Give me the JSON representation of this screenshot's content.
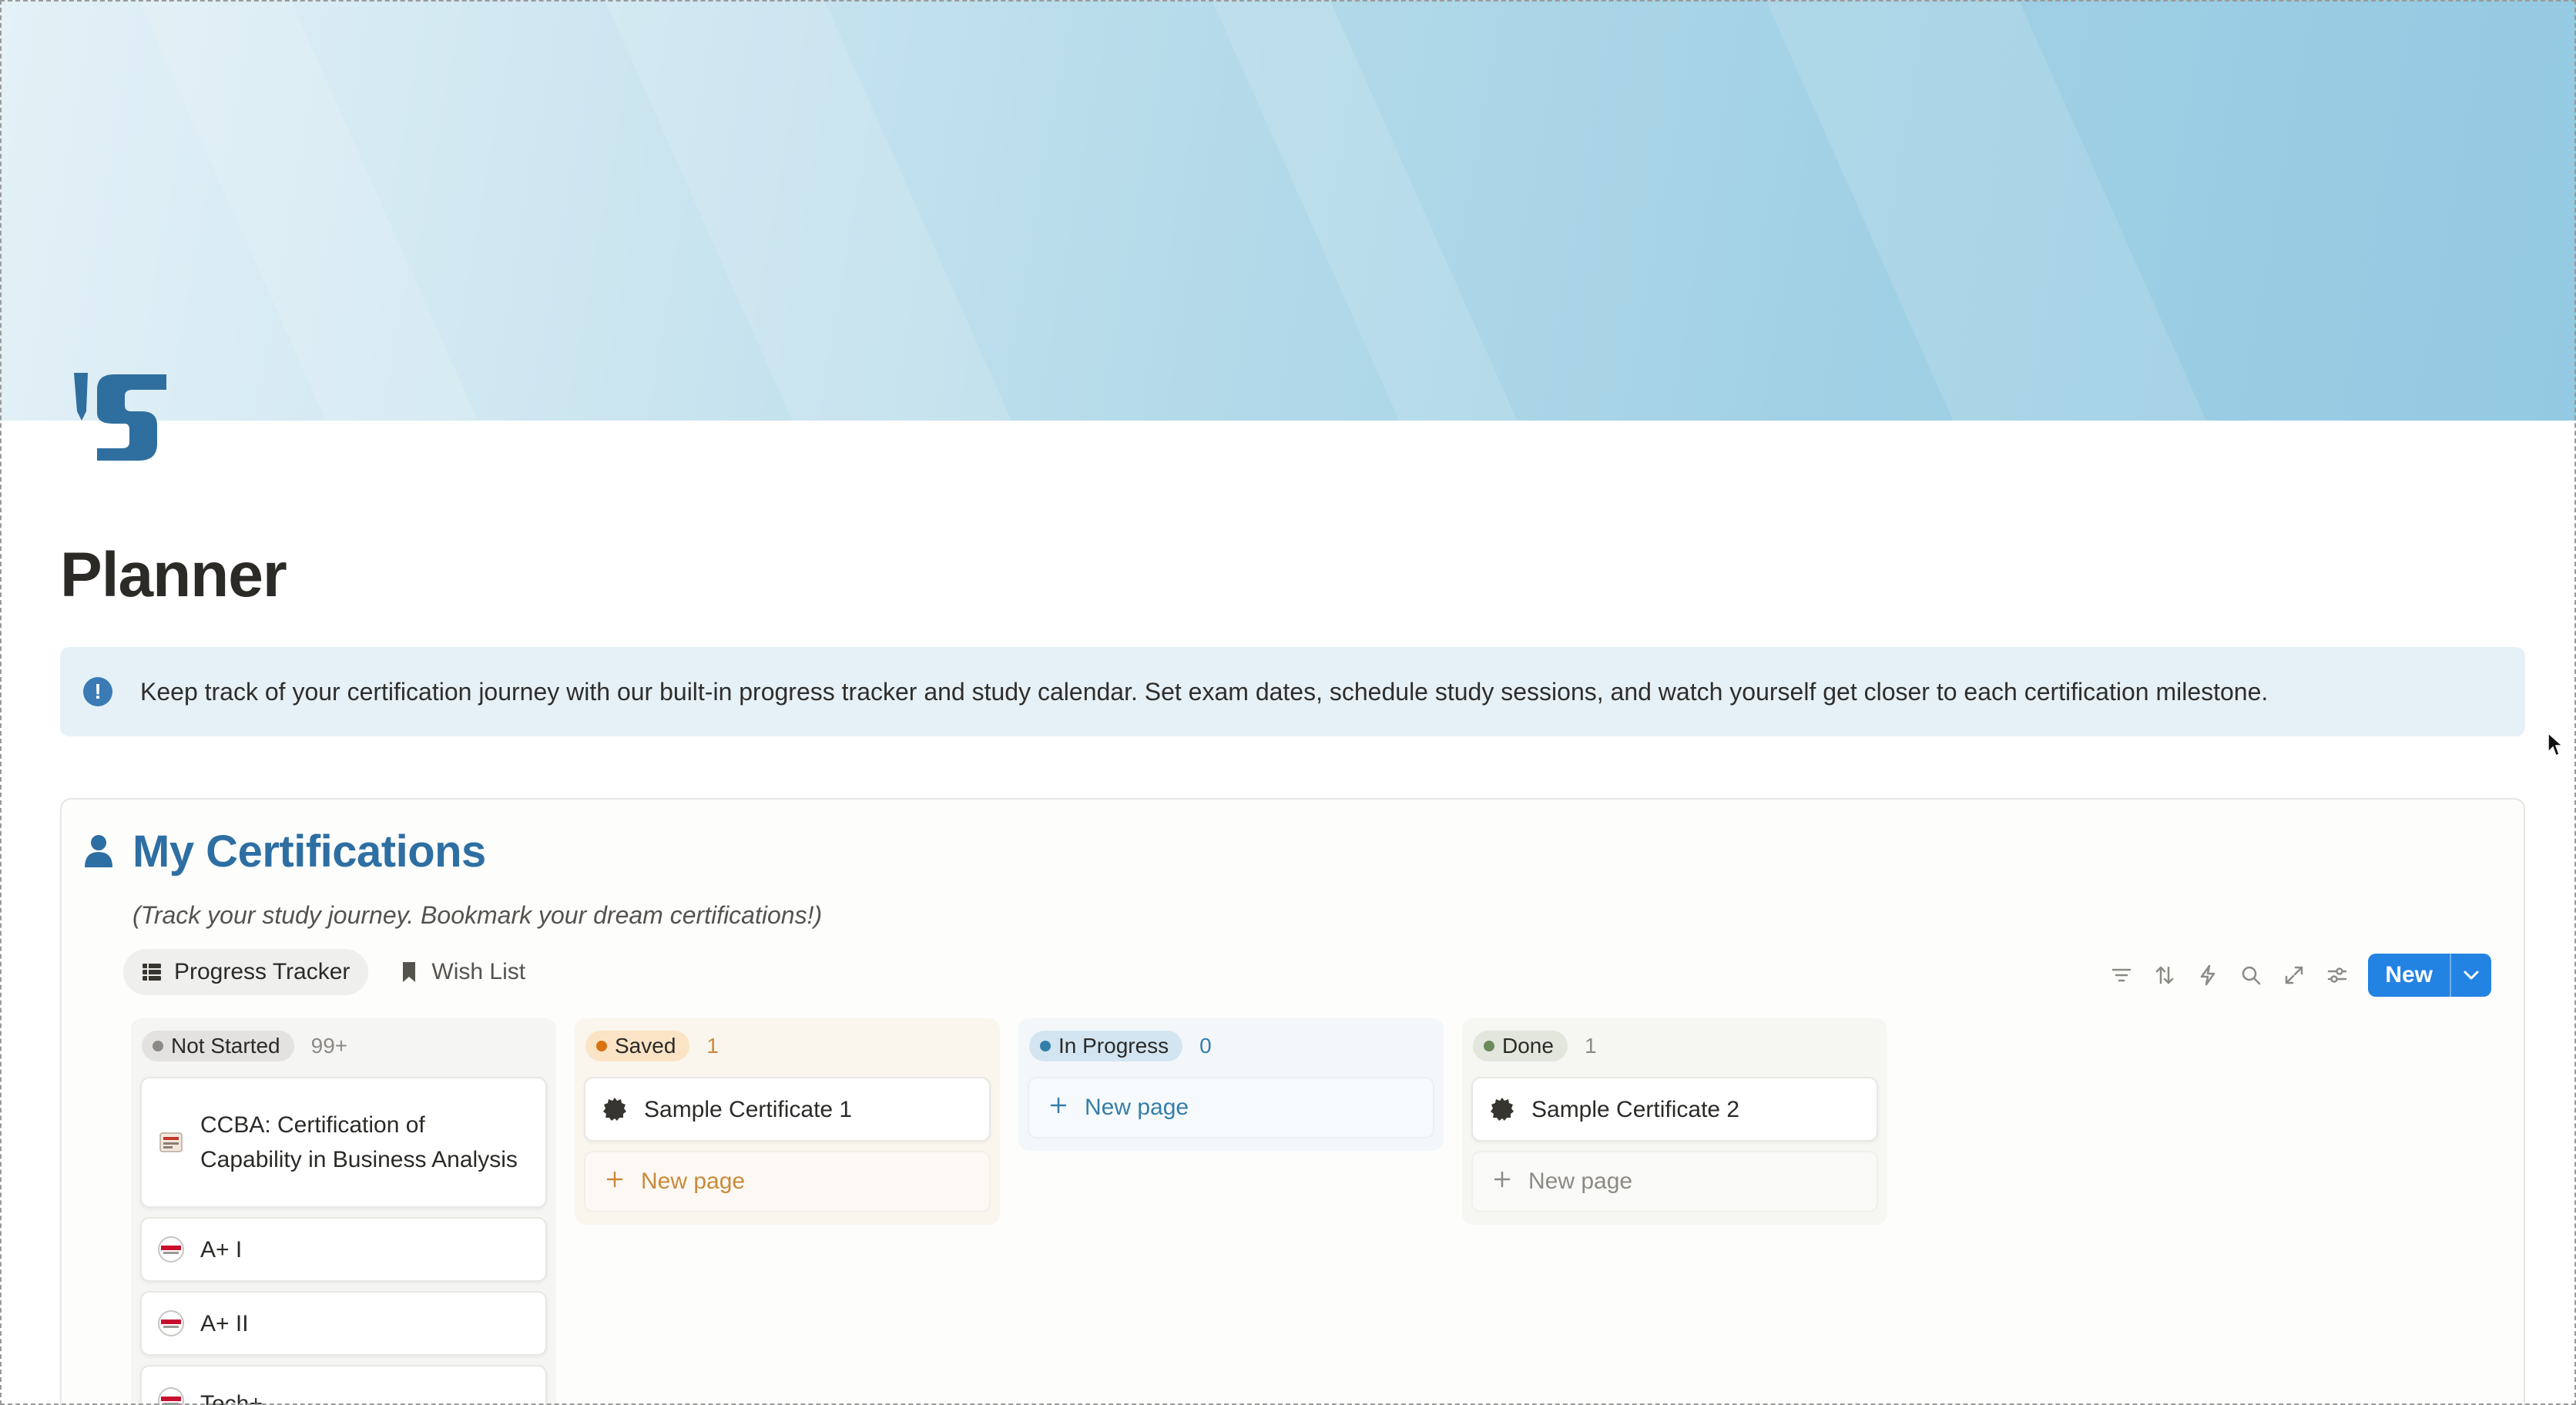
{
  "page": {
    "title": "Planner",
    "icon": "ss-logo-icon"
  },
  "callout": {
    "icon": "exclamation-icon",
    "text": "Keep track of your certification journey with our built-in progress tracker and study calendar. Set exam dates, schedule study sessions, and watch yourself get closer to each certification milestone."
  },
  "database": {
    "icon": "person-icon",
    "title": "My Certifications",
    "description": "(Track your study journey. Bookmark your dream certifications!)",
    "views": [
      {
        "label": "Progress Tracker",
        "icon": "table-icon",
        "active": true
      },
      {
        "label": "Wish List",
        "icon": "bookmark-icon",
        "active": false
      }
    ],
    "toolbar": {
      "icons": [
        "filter-icon",
        "sort-icon",
        "lightning-icon",
        "search-icon",
        "expand-icon",
        "settings-icon"
      ],
      "new_label": "New"
    }
  },
  "board": {
    "new_page_label": "New page",
    "columns": [
      {
        "status": "Not Started",
        "count": "99+",
        "colors": {
          "bg": "#f5f5f3",
          "pill": "#e3e2e0",
          "dot": "#8c8a85",
          "count": "#8c8a85"
        },
        "cards": [
          {
            "title": "CCBA: Certification of Capability in Business Analysis",
            "icon": "certificate-badge-icon"
          },
          {
            "title": "A+ I",
            "icon": "comptia-logo-icon"
          },
          {
            "title": "A+ II",
            "icon": "comptia-logo-icon"
          },
          {
            "title": "Tech+",
            "icon": "comptia-logo-icon"
          }
        ]
      },
      {
        "status": "Saved",
        "count": "1",
        "colors": {
          "bg": "#faf6ee",
          "pill": "#fbe4c6",
          "dot": "#d9730d",
          "count": "#c98a3a"
        },
        "cards": [
          {
            "title": "Sample Certificate 1",
            "icon": "gear-badge-icon"
          }
        ]
      },
      {
        "status": "In Progress",
        "count": "0",
        "colors": {
          "bg": "#f3f7fa",
          "pill": "#d3e5f1",
          "dot": "#337ea9",
          "count": "#337ea9"
        },
        "cards": []
      },
      {
        "status": "Done",
        "count": "1",
        "colors": {
          "bg": "#f6f6f3",
          "pill": "#e3e6dc",
          "dot": "#6b8a5a",
          "count": "#8c8a85"
        },
        "cards": [
          {
            "title": "Sample Certificate 2",
            "icon": "gear-badge-icon"
          }
        ]
      }
    ]
  }
}
